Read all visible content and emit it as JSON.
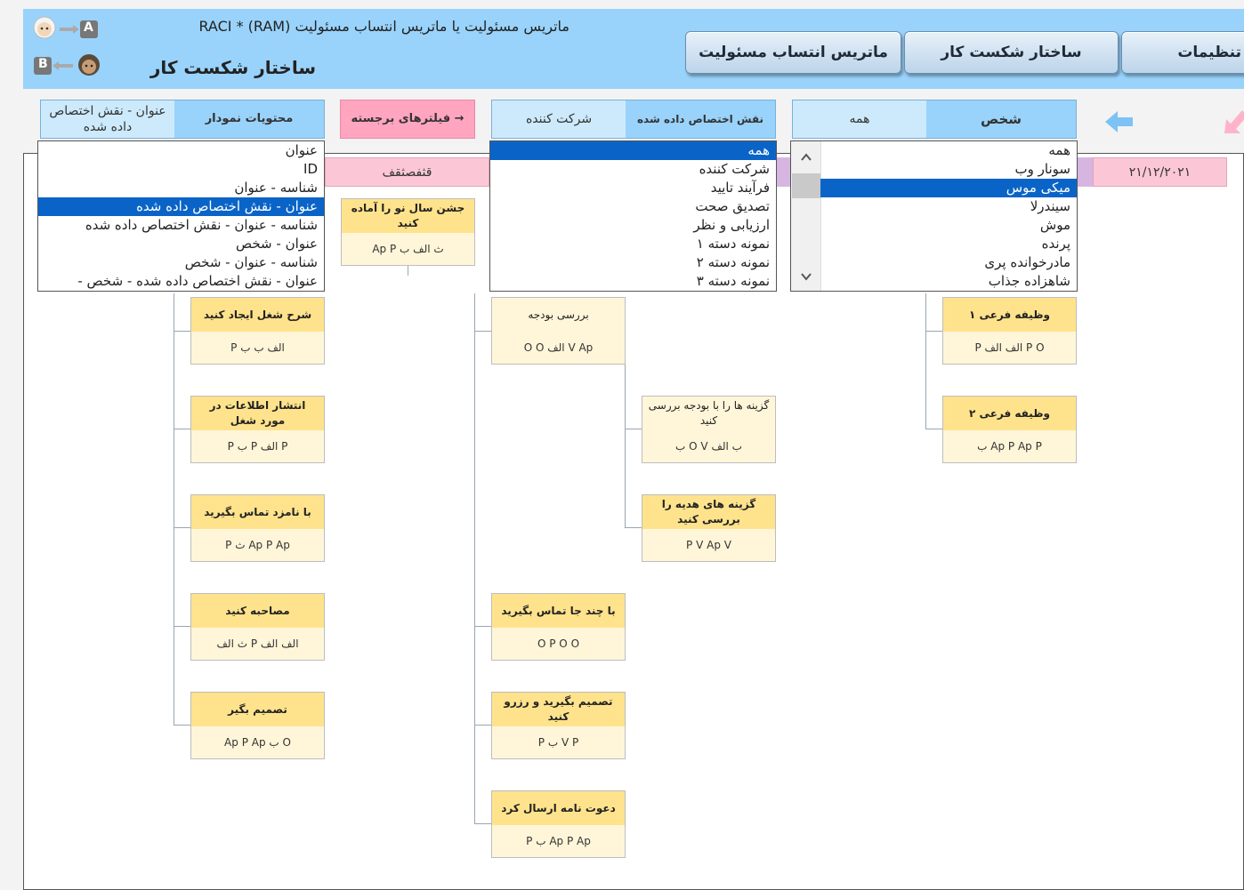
{
  "header": {
    "title_line": "ماتریس مسئولیت یا ماتریس انتساب مسئولیت RACI * (RAM)",
    "subtitle": "ساختار شکست کار",
    "avatar_a_label": "A",
    "avatar_b_label": "B",
    "nav": [
      {
        "label": "ماتریس انتساب مسئولیت"
      },
      {
        "label": "ساختار شکست کار"
      },
      {
        "label": "تنظیمات"
      }
    ]
  },
  "filters": {
    "chart_contents": {
      "label": "محتویات نمودار",
      "value": "عنوان - نقش اختصاص داده شده"
    },
    "highlight_filters": {
      "label": "→ فیلترهای برجسته"
    },
    "assigned_role": {
      "label": "نقش اختصاص داده شده",
      "value": "شرکت کننده"
    },
    "person": {
      "label": "شخص",
      "value": "همه"
    }
  },
  "lists": {
    "chart_contents_options": [
      "عنوان",
      "ID",
      "شناسه - عنوان",
      "عنوان - نقش اختصاص داده شده",
      "شناسه - عنوان - نقش اختصاص داده شده",
      "عنوان - شخص",
      "شناسه - عنوان - شخص",
      "عنوان - نقش اختصاص داده شده - شخص -"
    ],
    "chart_contents_selected_index": 3,
    "role_options": [
      "همه",
      "شرکت کننده",
      "فرآیند تایید",
      "تصدیق صحت",
      "ارزیابی و نظر",
      "نمونه دسته ۱",
      "نمونه دسته ۲",
      "نمونه دسته ۳"
    ],
    "role_selected_index": 0,
    "person_options": [
      "همه",
      "سونار وب",
      "میکی موس",
      "سیندرلا",
      "موش",
      "پرنده",
      "مادرخوانده پری",
      "شاهزاده جذاب"
    ],
    "person_selected_index": 2
  },
  "chart": {
    "date": "۲۱/۱۲/۲۰۲۱",
    "project_title": "قثفصثقف",
    "cards": [
      {
        "title": "جشن سال نو را آماده کنید",
        "roles": "ث الف ب Ap P"
      },
      {
        "title": "شرح شغل ایجاد کنید",
        "roles": "الف ب ب P"
      },
      {
        "title": "انتشار اطلاعات در مورد شغل",
        "roles": "P الف P ب P"
      },
      {
        "title": "با نامزد تماس بگیرید",
        "roles": "Ap P Ap ث P"
      },
      {
        "title": "مصاحبه کنید",
        "roles": "الف الف P ث الف"
      },
      {
        "title": "تصمیم بگیر",
        "roles": "O ب Ap P Ap"
      },
      {
        "title": "بررسی بودجه",
        "roles": "V Ap الف O O"
      },
      {
        "title": "گزینه ها را با بودجه بررسی کنید",
        "roles": "ب الف O V ب"
      },
      {
        "title": "گزینه های هدیه را بررسی کنید",
        "roles": "P V Ap V"
      },
      {
        "title": "با چند جا تماس بگیرید",
        "roles": "O P O O"
      },
      {
        "title": "تصمیم بگیرید و رزرو کنید",
        "roles": "V P ب P"
      },
      {
        "title": "دعوت نامه ارسال کرد",
        "roles": "Ap P Ap ب P"
      },
      {
        "title": "وظیفه فرعی ۱",
        "roles": "P O الف الف P"
      },
      {
        "title": "وظیفه فرعی ۲",
        "roles": "Ap P Ap P ب"
      }
    ]
  },
  "colors": {
    "header_bg": "#99d3fb",
    "card_title_bg": "#ffe38c",
    "card_body_bg": "#fff6d9",
    "selection": "#0a64c8",
    "highlight_button": "#ffa5c0"
  }
}
